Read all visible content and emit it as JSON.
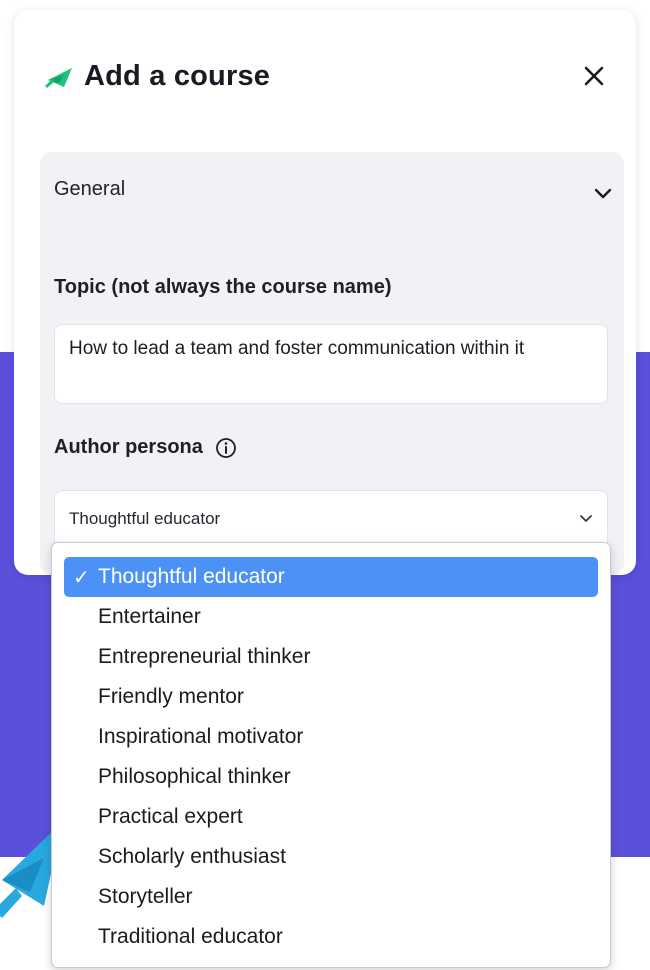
{
  "modal": {
    "title": "Add a course",
    "close_icon": "close-icon",
    "logo_icon": "paper-plane-icon",
    "accent_color": "#1fc27d"
  },
  "section": {
    "title": "General",
    "chevron_icon": "chevron-down-icon"
  },
  "topic": {
    "label": "Topic (not always the course name)",
    "value": "How to lead a team and foster communication within it"
  },
  "persona": {
    "label": "Author persona",
    "info_icon": "info-icon",
    "selected": "Thoughtful educator",
    "options": [
      {
        "label": "Thoughtful educator",
        "selected": true,
        "check": "✓"
      },
      {
        "label": "Entertainer",
        "selected": false,
        "check": ""
      },
      {
        "label": "Entrepreneurial thinker",
        "selected": false,
        "check": ""
      },
      {
        "label": "Friendly mentor",
        "selected": false,
        "check": ""
      },
      {
        "label": "Inspirational motivator",
        "selected": false,
        "check": ""
      },
      {
        "label": "Philosophical thinker",
        "selected": false,
        "check": ""
      },
      {
        "label": "Practical expert",
        "selected": false,
        "check": ""
      },
      {
        "label": "Scholarly enthusiast",
        "selected": false,
        "check": ""
      },
      {
        "label": "Storyteller",
        "selected": false,
        "check": ""
      },
      {
        "label": "Traditional educator",
        "selected": false,
        "check": ""
      }
    ]
  },
  "colors": {
    "background_band": "#5b50dc",
    "selection_highlight": "#4c91f6",
    "decorative_plane": "#29a8e0"
  }
}
